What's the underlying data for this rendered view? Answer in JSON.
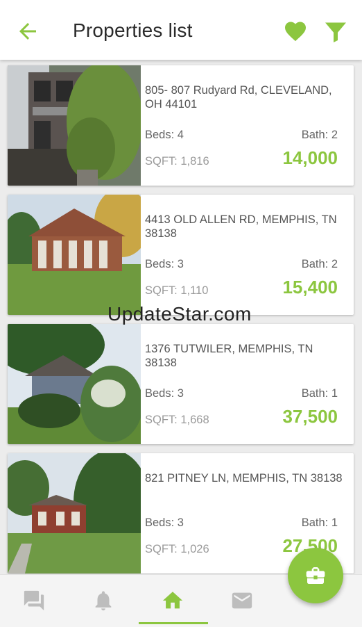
{
  "header": {
    "title": "Properties list"
  },
  "watermark": "UpdateStar.com",
  "properties": [
    {
      "address": "805- 807 Rudyard Rd, CLEVELAND, OH 44101",
      "beds": "Beds: 4",
      "bath": "Bath: 2",
      "sqft": "SQFT: 1,816",
      "price": "14,000"
    },
    {
      "address": "4413 OLD ALLEN RD, MEMPHIS, TN 38138",
      "beds": "Beds: 3",
      "bath": "Bath: 2",
      "sqft": "SQFT: 1,110",
      "price": "15,400"
    },
    {
      "address": "1376 TUTWILER, MEMPHIS, TN 38138",
      "beds": "Beds: 3",
      "bath": "Bath: 1",
      "sqft": "SQFT: 1,668",
      "price": "37,500"
    },
    {
      "address": "821 PITNEY LN, MEMPHIS, TN 38138",
      "beds": "Beds: 3",
      "bath": "Bath: 1",
      "sqft": "SQFT: 1,026",
      "price": "27,500"
    }
  ],
  "bottom_nav": {
    "items": [
      {
        "icon": "chat-icon",
        "active": false
      },
      {
        "icon": "bell-icon",
        "active": false
      },
      {
        "icon": "home-icon",
        "active": true
      },
      {
        "icon": "mail-icon",
        "active": false
      }
    ]
  },
  "fab": {
    "icon": "briefcase-icon"
  },
  "colors": {
    "accent": "#8cc63f",
    "title": "#2b2b2b",
    "text": "#555555",
    "inactive_icon": "#bdbdbd"
  }
}
